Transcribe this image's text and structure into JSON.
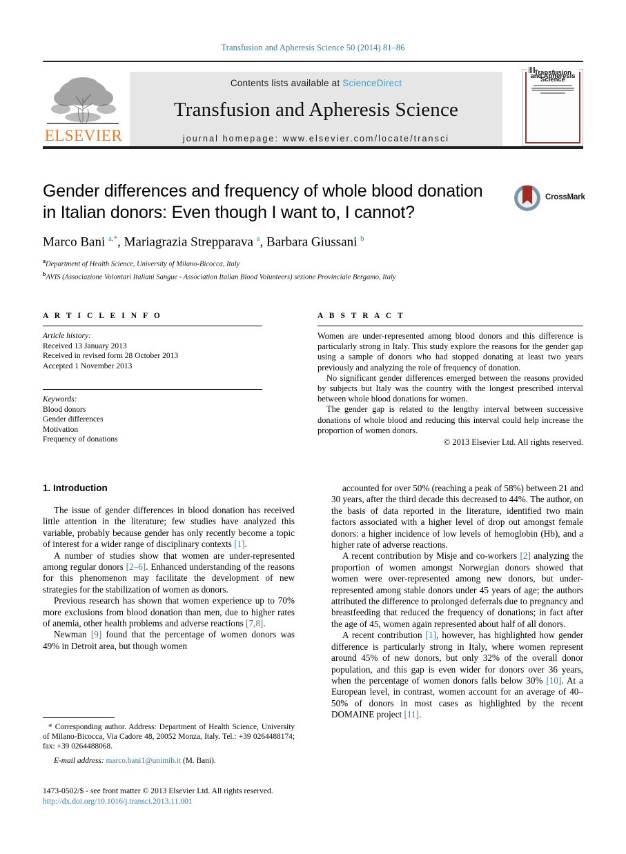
{
  "running_head": "Transfusion and Apheresis Science 50 (2014) 81–86",
  "masthead": {
    "contents_prefix": "Contents lists available at ",
    "sciencedirect": "ScienceDirect",
    "journal_title": "Transfusion and Apheresis Science",
    "homepage": "journal homepage: www.elsevier.com/locate/transci",
    "publisher_wordmark": "ELSEVIER",
    "cover_title_line1": "Transfusion",
    "cover_title_line2": "and Apheresis",
    "cover_title_line3": "Science",
    "accent_link_color": "#3f9fd0",
    "publisher_color": "#e87722",
    "cover_border_color": "#8d3b33"
  },
  "article": {
    "title": "Gender differences and frequency of whole blood donation in Italian donors: Even though I want to, I cannot?",
    "title_line1": "Gender differences and frequency of whole blood donation",
    "title_line2": "in Italian donors: Even though I want to, I cannot?",
    "crossmark_label": "CrossMark",
    "authors_html": "Marco Bani <sup>a,*</sup>, Mariagrazia Strepparava <sup>a</sup>, Barbara Giussani <sup>b</sup>",
    "affiliations": [
      {
        "marker": "a",
        "text": "Department of Health Science, University of Milano-Bicocca, Italy"
      },
      {
        "marker": "b",
        "text": "AVIS (Associazione Volontari Italiani Sangue - Association Italian Blood Volunteers) sezione Provinciale Bergamo, Italy"
      }
    ]
  },
  "article_info": {
    "heading": "A R T I C L E    I N F O",
    "history_label": "Article history:",
    "history": [
      "Received 13 January 2013",
      "Received in revised form 28 October 2013",
      "Accepted 1 November 2013"
    ],
    "keywords_label": "Keywords:",
    "keywords": [
      "Blood donors",
      "Gender differences",
      "Motivation",
      "Frequency of donations"
    ]
  },
  "abstract": {
    "heading": "A B S T R A C T",
    "paragraphs": [
      "Women are under-represented among blood donors and this difference is particularly strong in Italy. This study explore the reasons for the gender gap using a sample of donors who had stopped donating at least two years previously and analyzing the role of frequency of donation.",
      "No significant gender differences emerged between the reasons provided by subjects but Italy was the country with the longest prescribed interval between whole blood donations for women.",
      "The gender gap is related to the lengthy interval between successive donations of whole blood and reducing this interval could help increase the proportion of women donors."
    ],
    "copyright": "© 2013 Elsevier Ltd. All rights reserved."
  },
  "body": {
    "section_heading": "1. Introduction",
    "left_paragraphs": [
      {
        "parts": [
          {
            "t": "The issue of gender differences in blood donation has received little attention in the literature; few studies have analyzed this variable, probably because gender has only recently become a topic of interest for a wider range of disciplinary contexts "
          },
          {
            "t": "[1]",
            "ref": true
          },
          {
            "t": "."
          }
        ]
      },
      {
        "parts": [
          {
            "t": "A number of studies show that women are under-represented among regular donors "
          },
          {
            "t": "[2–6]",
            "ref": true
          },
          {
            "t": ". Enhanced understanding of the reasons for this phenomenon may facilitate the development of new strategies for the stabilization of women as donors."
          }
        ]
      },
      {
        "parts": [
          {
            "t": "Previous research has shown that women experience up to 70% more exclusions from blood donation than men, due to higher rates of anemia, other health problems and adverse reactions "
          },
          {
            "t": "[7,8]",
            "ref": true
          },
          {
            "t": "."
          }
        ]
      },
      {
        "parts": [
          {
            "t": "Newman "
          },
          {
            "t": "[9]",
            "ref": true
          },
          {
            "t": " found that the percentage of women donors was 49% in Detroit area, but though women"
          }
        ]
      }
    ],
    "right_paragraphs": [
      {
        "parts": [
          {
            "t": "accounted for over 50% (reaching a peak of 58%) between 21 and 30 years, after the third decade this decreased to 44%. The author, on the basis of data reported in the literature, identified two main factors associated with a higher level of drop out amongst female donors: a higher incidence of low levels of hemoglobin (Hb), and a higher rate of adverse reactions."
          }
        ]
      },
      {
        "parts": [
          {
            "t": "A recent contribution by Misje and co-workers "
          },
          {
            "t": "[2]",
            "ref": true
          },
          {
            "t": " analyzing the proportion of women amongst Norwegian donors showed that women were over-represented among new donors, but under-represented among stable donors under 45 years of age; the authors attributed the difference to prolonged deferrals due to pregnancy and breastfeeding that reduced the frequency of donations; in fact after the age of 45, women again represented about half of all donors."
          }
        ]
      },
      {
        "parts": [
          {
            "t": "A recent contribution "
          },
          {
            "t": "[1]",
            "ref": true
          },
          {
            "t": ", however, has highlighted how gender difference is particularly strong in Italy, where women represent around 45% of new donors, but only 32% of the overall donor population, and this gap is even wider for donors over 36 years, when the percentage of women donors falls below 30% "
          },
          {
            "t": "[10]",
            "ref": true
          },
          {
            "t": ". At a European level, in contrast, women account for an average of 40–50% of donors in most cases as highlighted by the recent DOMAINE project "
          },
          {
            "t": "[11]",
            "ref": true
          },
          {
            "t": "."
          }
        ]
      }
    ]
  },
  "footnotes": {
    "corresponding": "* Corresponding author. Address: Department of Health Science, University of Milano-Bicocca, Via Cadore 48, 20052 Monza, Italy. Tel.: +39 0264488174; fax: +39 0264488068.",
    "email_label": "E-mail address:",
    "email": "marco.bani1@unimib.it",
    "email_owner": "(M. Bani)."
  },
  "imprint": {
    "line1": "1473-0502/$ - see front matter © 2013 Elsevier Ltd. All rights reserved.",
    "doi": "http://dx.doi.org/10.1016/j.transci.2013.11.001"
  }
}
